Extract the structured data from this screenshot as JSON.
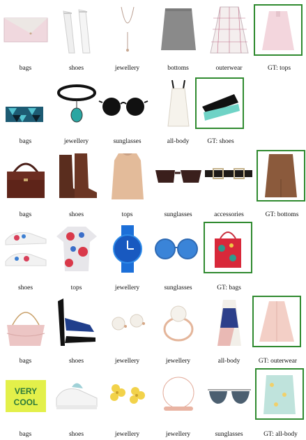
{
  "rows": [
    {
      "items": [
        "bags",
        "shoes",
        "jewellery",
        "bottoms",
        "outerwear"
      ],
      "gt": "GT: tops"
    },
    {
      "items": [
        "bags",
        "jewellery",
        "sunglasses",
        "all-body"
      ],
      "gt": "GT: shoes"
    },
    {
      "items": [
        "bags",
        "shoes",
        "tops",
        "sunglasses",
        "accessories"
      ],
      "gt": "GT: bottoms"
    },
    {
      "items": [
        "shoes",
        "tops",
        "jewellery",
        "sunglasses"
      ],
      "gt": "GT: bags"
    },
    {
      "items": [
        "bags",
        "shoes",
        "jewellery",
        "jewellery",
        "all-body"
      ],
      "gt": "GT: outerwear"
    },
    {
      "items": [
        "bags",
        "shoes",
        "jewellery",
        "jewellery",
        "sunglasses"
      ],
      "gt": "GT: all-body"
    }
  ],
  "colors": {
    "gt_border": "#2f8a2f"
  },
  "product_images": {
    "lettering": "VERY COOL"
  }
}
